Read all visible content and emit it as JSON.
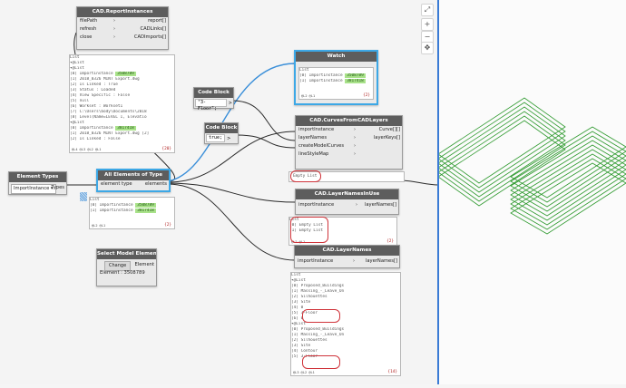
{
  "nodes": {
    "report": {
      "title": "CAD.ReportInstances",
      "inputs": [
        "filePath",
        "refresh",
        "close"
      ],
      "outputs": [
        "report[]",
        "CADLinks[]",
        "CADImports[]"
      ]
    },
    "report_preview": {
      "lines": [
        "List",
        "  ▾@List",
        "    ▾@List",
        "      [0] ImportInstance",
        "      [1] 2018_0326 MINT Export.dwg",
        "      [2] Is Linked : True",
        "      [3] Status : Loaded",
        "      [4] View Specific : False",
        "      [5] null",
        "      [6] Workset : Workset1",
        "      [7] C:\\Users\\body\\Documents\\2018",
        "      [8] Level(Name=LEVEL 1, Elevatio",
        "    ▾@List",
        "      [0] ImportInstance",
        "      [1] 2018_0326 MINT Export.dwg [2]",
        "      [2] Is Linked : False"
      ],
      "ids": [
        "3508789",
        "3817418"
      ],
      "footer": "@L4 @L3 @L2 @L1",
      "count": "{20}"
    },
    "watch": {
      "title": "Watch",
      "lines": [
        "List",
        "  [0] ImportInstance",
        "  [1] ImportInstance"
      ],
      "ids": [
        "3508789",
        "3817418"
      ],
      "footer": "@L2 @L1",
      "count": "{2}"
    },
    "codeblock1": {
      "title": "Code Block",
      "code": "\"3-Floor\";",
      "port": ">"
    },
    "codeblock2": {
      "title": "Code Block",
      "code": "true;",
      "port": ">"
    },
    "element_types": {
      "title": "Element Types",
      "value": "ImportInstance",
      "output": "Types"
    },
    "all_elements": {
      "title": "All Elements of Type",
      "input": "element type",
      "output": "elements"
    },
    "all_elements_preview": {
      "lines": [
        "List",
        "  [0] ImportInstance",
        "  [1] ImportInstance"
      ],
      "ids": [
        "3508789",
        "3817418"
      ],
      "footer": "@L2 @L1",
      "count": "{2}"
    },
    "curves": {
      "title": "CAD.CurvesFromCADLayers",
      "inputs": [
        "importInstance",
        "layerNames",
        "createModelCurves",
        "lineStyleMap"
      ],
      "outputs": [
        "Curve[][]",
        "layerKeys[]"
      ],
      "preview": "Empty List"
    },
    "layers_in_use": {
      "title": "CAD.LayerNamesInUse",
      "input": "importInstance",
      "output": "layerNames[]"
    },
    "layers_in_use_preview": {
      "lines": [
        "List",
        "  [0] Empty List",
        "  [1] Empty List"
      ],
      "footer": "@L2 @L1",
      "count": "{2}"
    },
    "select_model": {
      "title": "Select Model Element",
      "button": "Change",
      "output": "Element",
      "status": "Element : 3508789"
    },
    "layer_names": {
      "title": "CAD.LayerNames",
      "input": "importInstance",
      "output": "layerNames[]"
    },
    "layer_names_preview": {
      "lines": [
        "List",
        "  ▾@List",
        "    [0] Proposed_Buildings",
        "    [1] Massing_-_Leave_On",
        "    [2] Silhouettes",
        "    [3] Site",
        "    [4] 0",
        "    [5] 3-Floor",
        "    [6] 0",
        "  ▾@List",
        "    [0] Proposed_Buildings",
        "    [1] Massing_-_Leave_On",
        "    [2] Silhouettes",
        "    [3] Site",
        "    [4] Contour",
        "    [5] 3-Floor"
      ],
      "footer": "@L3 @L2 @L1",
      "count": "{14}"
    }
  },
  "toolbar": {
    "buttons": [
      "search-icon",
      "plus-icon",
      "minus-icon",
      "move-icon"
    ],
    "glyphs": [
      "⤢",
      "+",
      "−",
      "✥"
    ]
  },
  "colors": {
    "wire": "#2a2a2a",
    "wire_selected": "#3a8fd9",
    "preview_green": "#a9e28a",
    "highlight_red": "#d0343b",
    "geometry": "#2f9a2f"
  }
}
